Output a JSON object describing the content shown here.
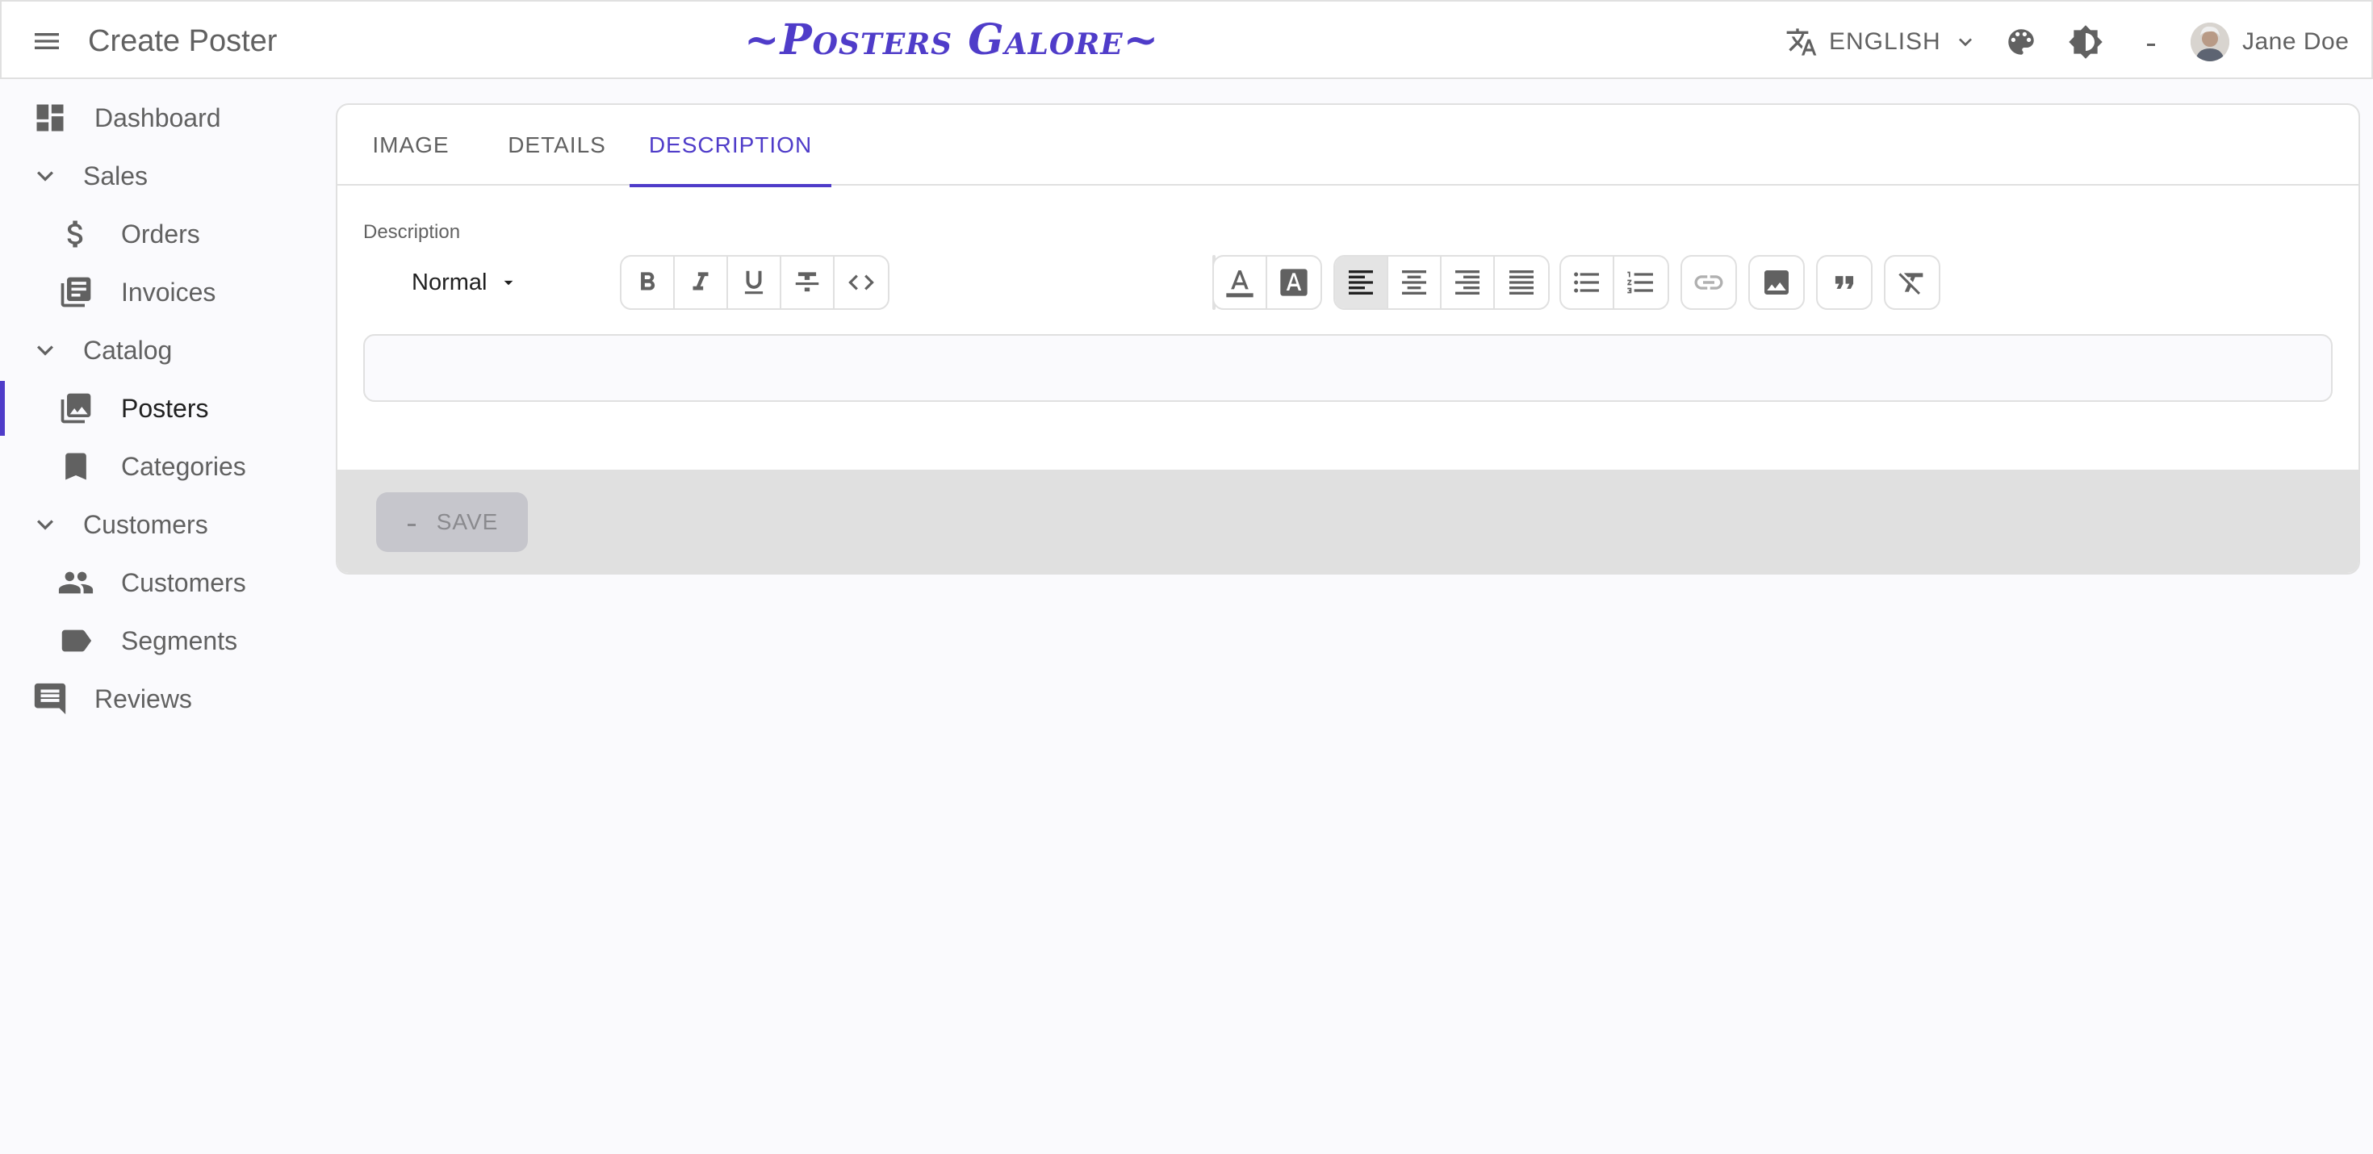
{
  "app": {
    "title": "Create Poster",
    "brand": "~Posters Galore~",
    "language": "ENGLISH",
    "user_name": "Jane Doe",
    "accent_color": "#4f3cc9"
  },
  "icons": {
    "menu": "hamburger-menu-icon",
    "language": "translate-icon",
    "theme": "palette-icon",
    "brightness": "brightness-icon",
    "loading": "loading-icon"
  },
  "sidebar": {
    "items": [
      {
        "label": "Dashboard",
        "icon": "dashboard-icon",
        "level": 0
      },
      {
        "label": "Sales",
        "icon": "chevron-down-icon",
        "level": 0,
        "group": true
      },
      {
        "label": "Orders",
        "icon": "dollar-icon",
        "level": 1
      },
      {
        "label": "Invoices",
        "icon": "invoices-icon",
        "level": 1
      },
      {
        "label": "Catalog",
        "icon": "chevron-down-icon",
        "level": 0,
        "group": true
      },
      {
        "label": "Posters",
        "icon": "collections-icon",
        "level": 1,
        "active": true
      },
      {
        "label": "Categories",
        "icon": "bookmark-icon",
        "level": 1
      },
      {
        "label": "Customers",
        "icon": "chevron-down-icon",
        "level": 0,
        "group": true
      },
      {
        "label": "Customers",
        "icon": "people-icon",
        "level": 1
      },
      {
        "label": "Segments",
        "icon": "label-icon",
        "level": 1
      },
      {
        "label": "Reviews",
        "icon": "comment-icon",
        "level": 0
      }
    ]
  },
  "main": {
    "tabs": [
      {
        "label": "IMAGE"
      },
      {
        "label": "DETAILS"
      },
      {
        "label": "DESCRIPTION",
        "active": true
      }
    ],
    "description_label": "Description",
    "block_type": "Normal",
    "editor_value": "",
    "save_label": "SAVE"
  }
}
